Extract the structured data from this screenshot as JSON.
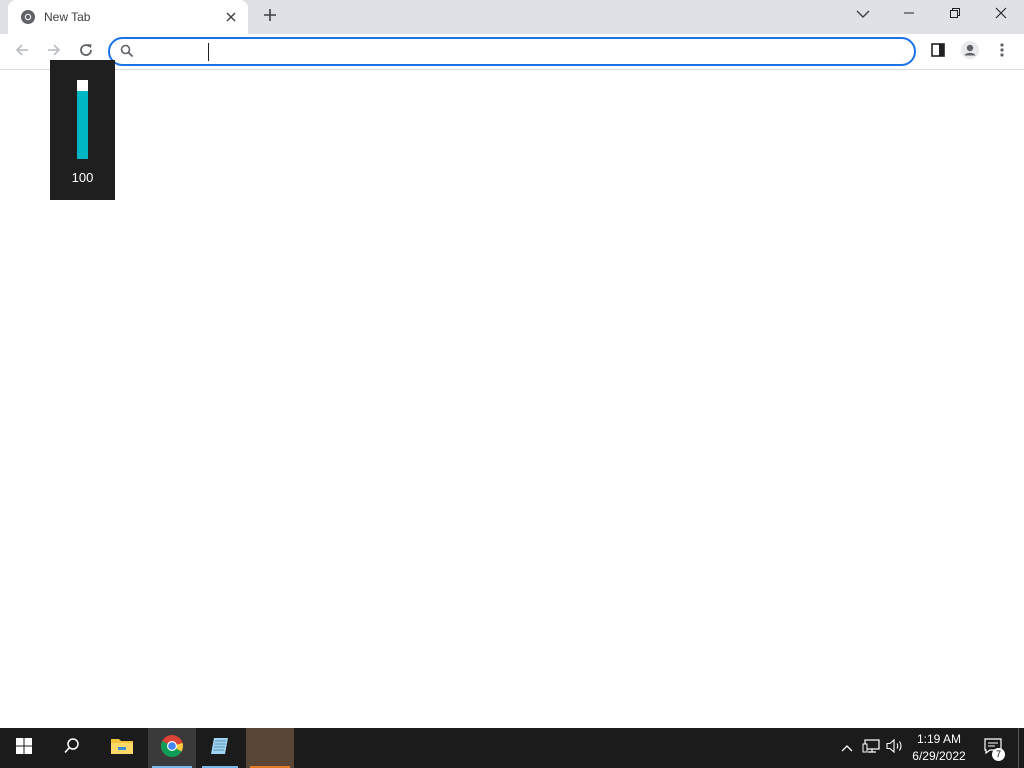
{
  "browser": {
    "tab": {
      "title": "New Tab",
      "favicon": "chrome-icon"
    },
    "new_tab_icon": "plus-icon",
    "tab_search_icon": "chevron-down-icon",
    "window_controls": [
      "minimize-icon",
      "restore-icon",
      "close-icon"
    ]
  },
  "toolbar": {
    "back_icon": "arrow-left-icon",
    "forward_icon": "arrow-right-icon",
    "reload_icon": "reload-icon",
    "omnibox": {
      "value": "",
      "placeholder": "",
      "icon": "search-icon"
    },
    "side_panel_icon": "side-panel-icon",
    "profile_icon": "profile-icon",
    "menu_icon": "kebab-menu-icon"
  },
  "volume_overlay": {
    "level_text": "100",
    "level_fraction": 1.0,
    "accent": "#00b7c3"
  },
  "taskbar": {
    "items": [
      "windows-start-icon",
      "search-icon",
      "file-explorer-icon",
      "chrome-icon",
      "notepad-icon",
      "app-icon"
    ],
    "tray": [
      "chevron-up-icon",
      "network-icon",
      "volume-icon"
    ],
    "time": "1:19 AM",
    "date": "6/29/2022",
    "notification_count": "7"
  },
  "colors": {
    "accent": "#1a73e8",
    "taskbar": "#1b1b1b",
    "tabstrip": "#dee1e6"
  }
}
